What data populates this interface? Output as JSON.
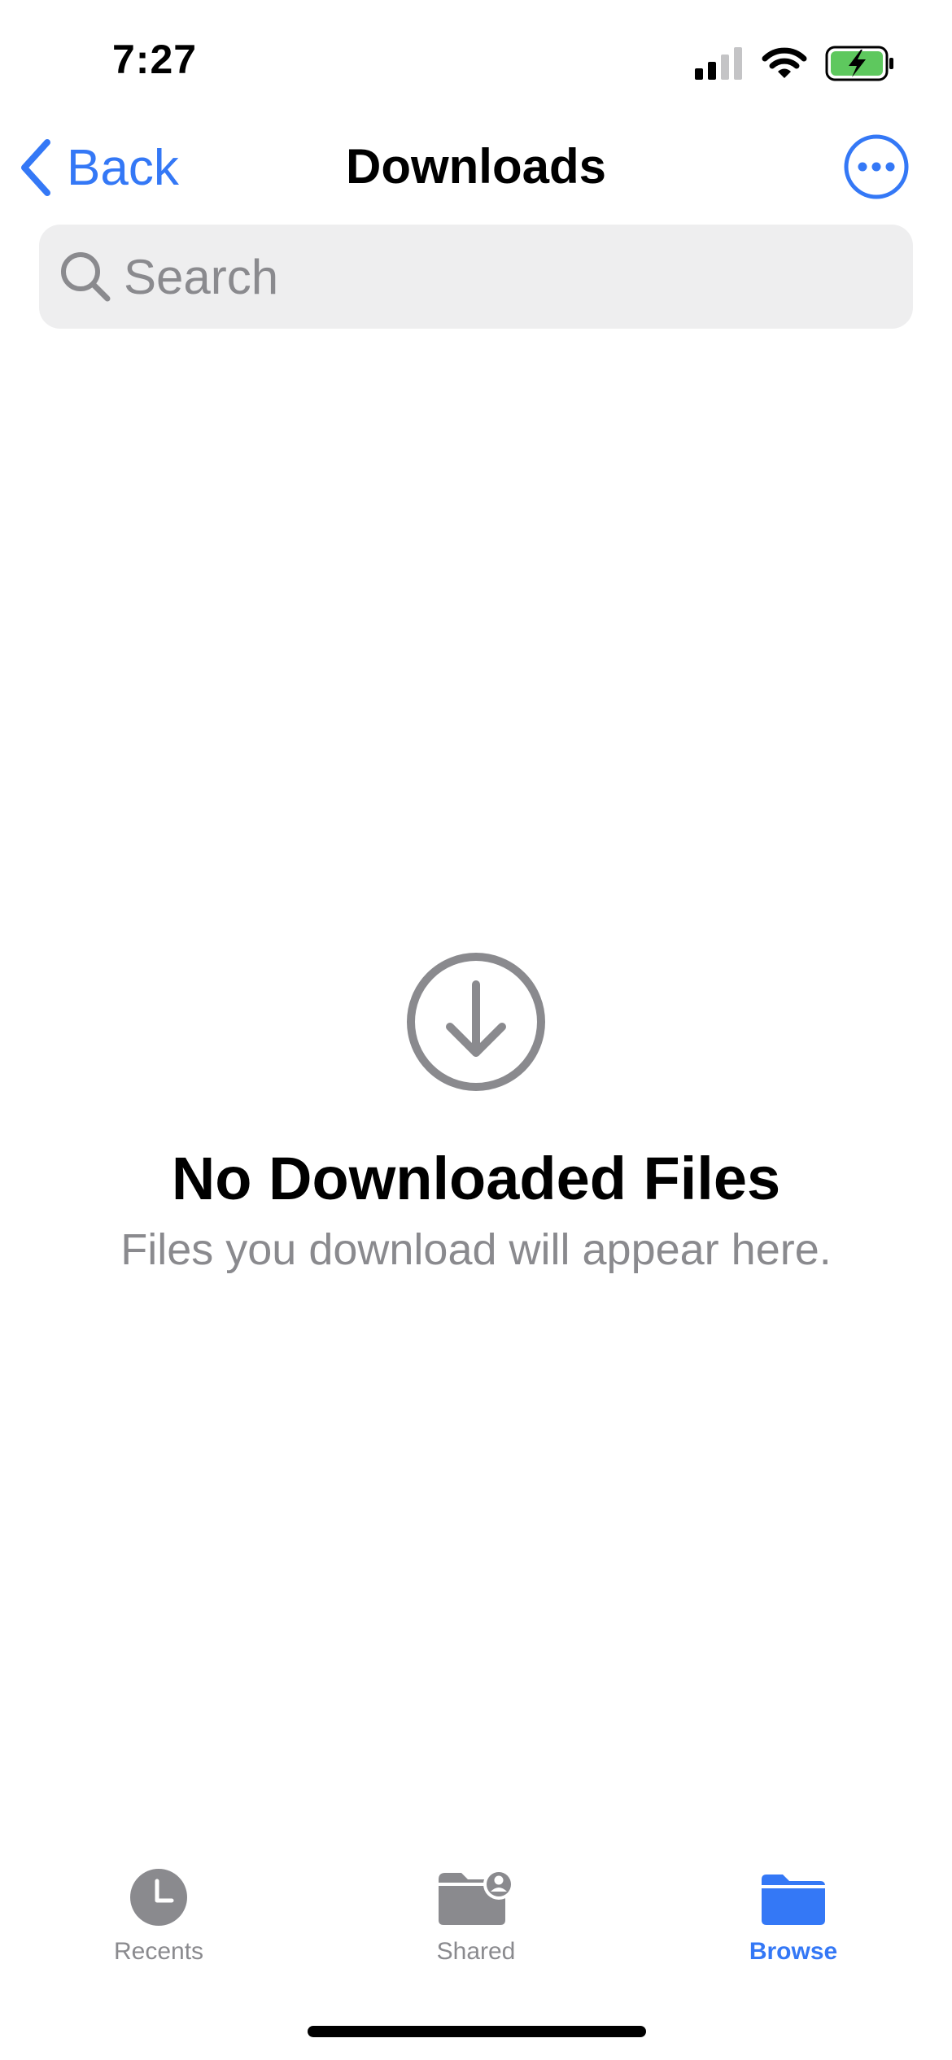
{
  "status_bar": {
    "time": "7:27",
    "icons": [
      "cellular-signal-icon",
      "wifi-icon",
      "battery-charging-icon"
    ]
  },
  "nav": {
    "back_label": "Back",
    "title": "Downloads",
    "more_icon": "ellipsis-circle-icon"
  },
  "search": {
    "placeholder": "Search",
    "value": ""
  },
  "empty_state": {
    "icon": "arrow-down-circle-icon",
    "title": "No Downloaded Files",
    "subtitle": "Files you download will appear here."
  },
  "tabs": [
    {
      "label": "Recents",
      "icon": "clock-icon",
      "active": false
    },
    {
      "label": "Shared",
      "icon": "shared-folder-icon",
      "active": false
    },
    {
      "label": "Browse",
      "icon": "folder-icon",
      "active": true
    }
  ],
  "colors": {
    "accent": "#3478f6",
    "secondary_text": "#8a8a8e",
    "search_background": "#eeeeef",
    "battery_fill": "#5ec85e"
  }
}
